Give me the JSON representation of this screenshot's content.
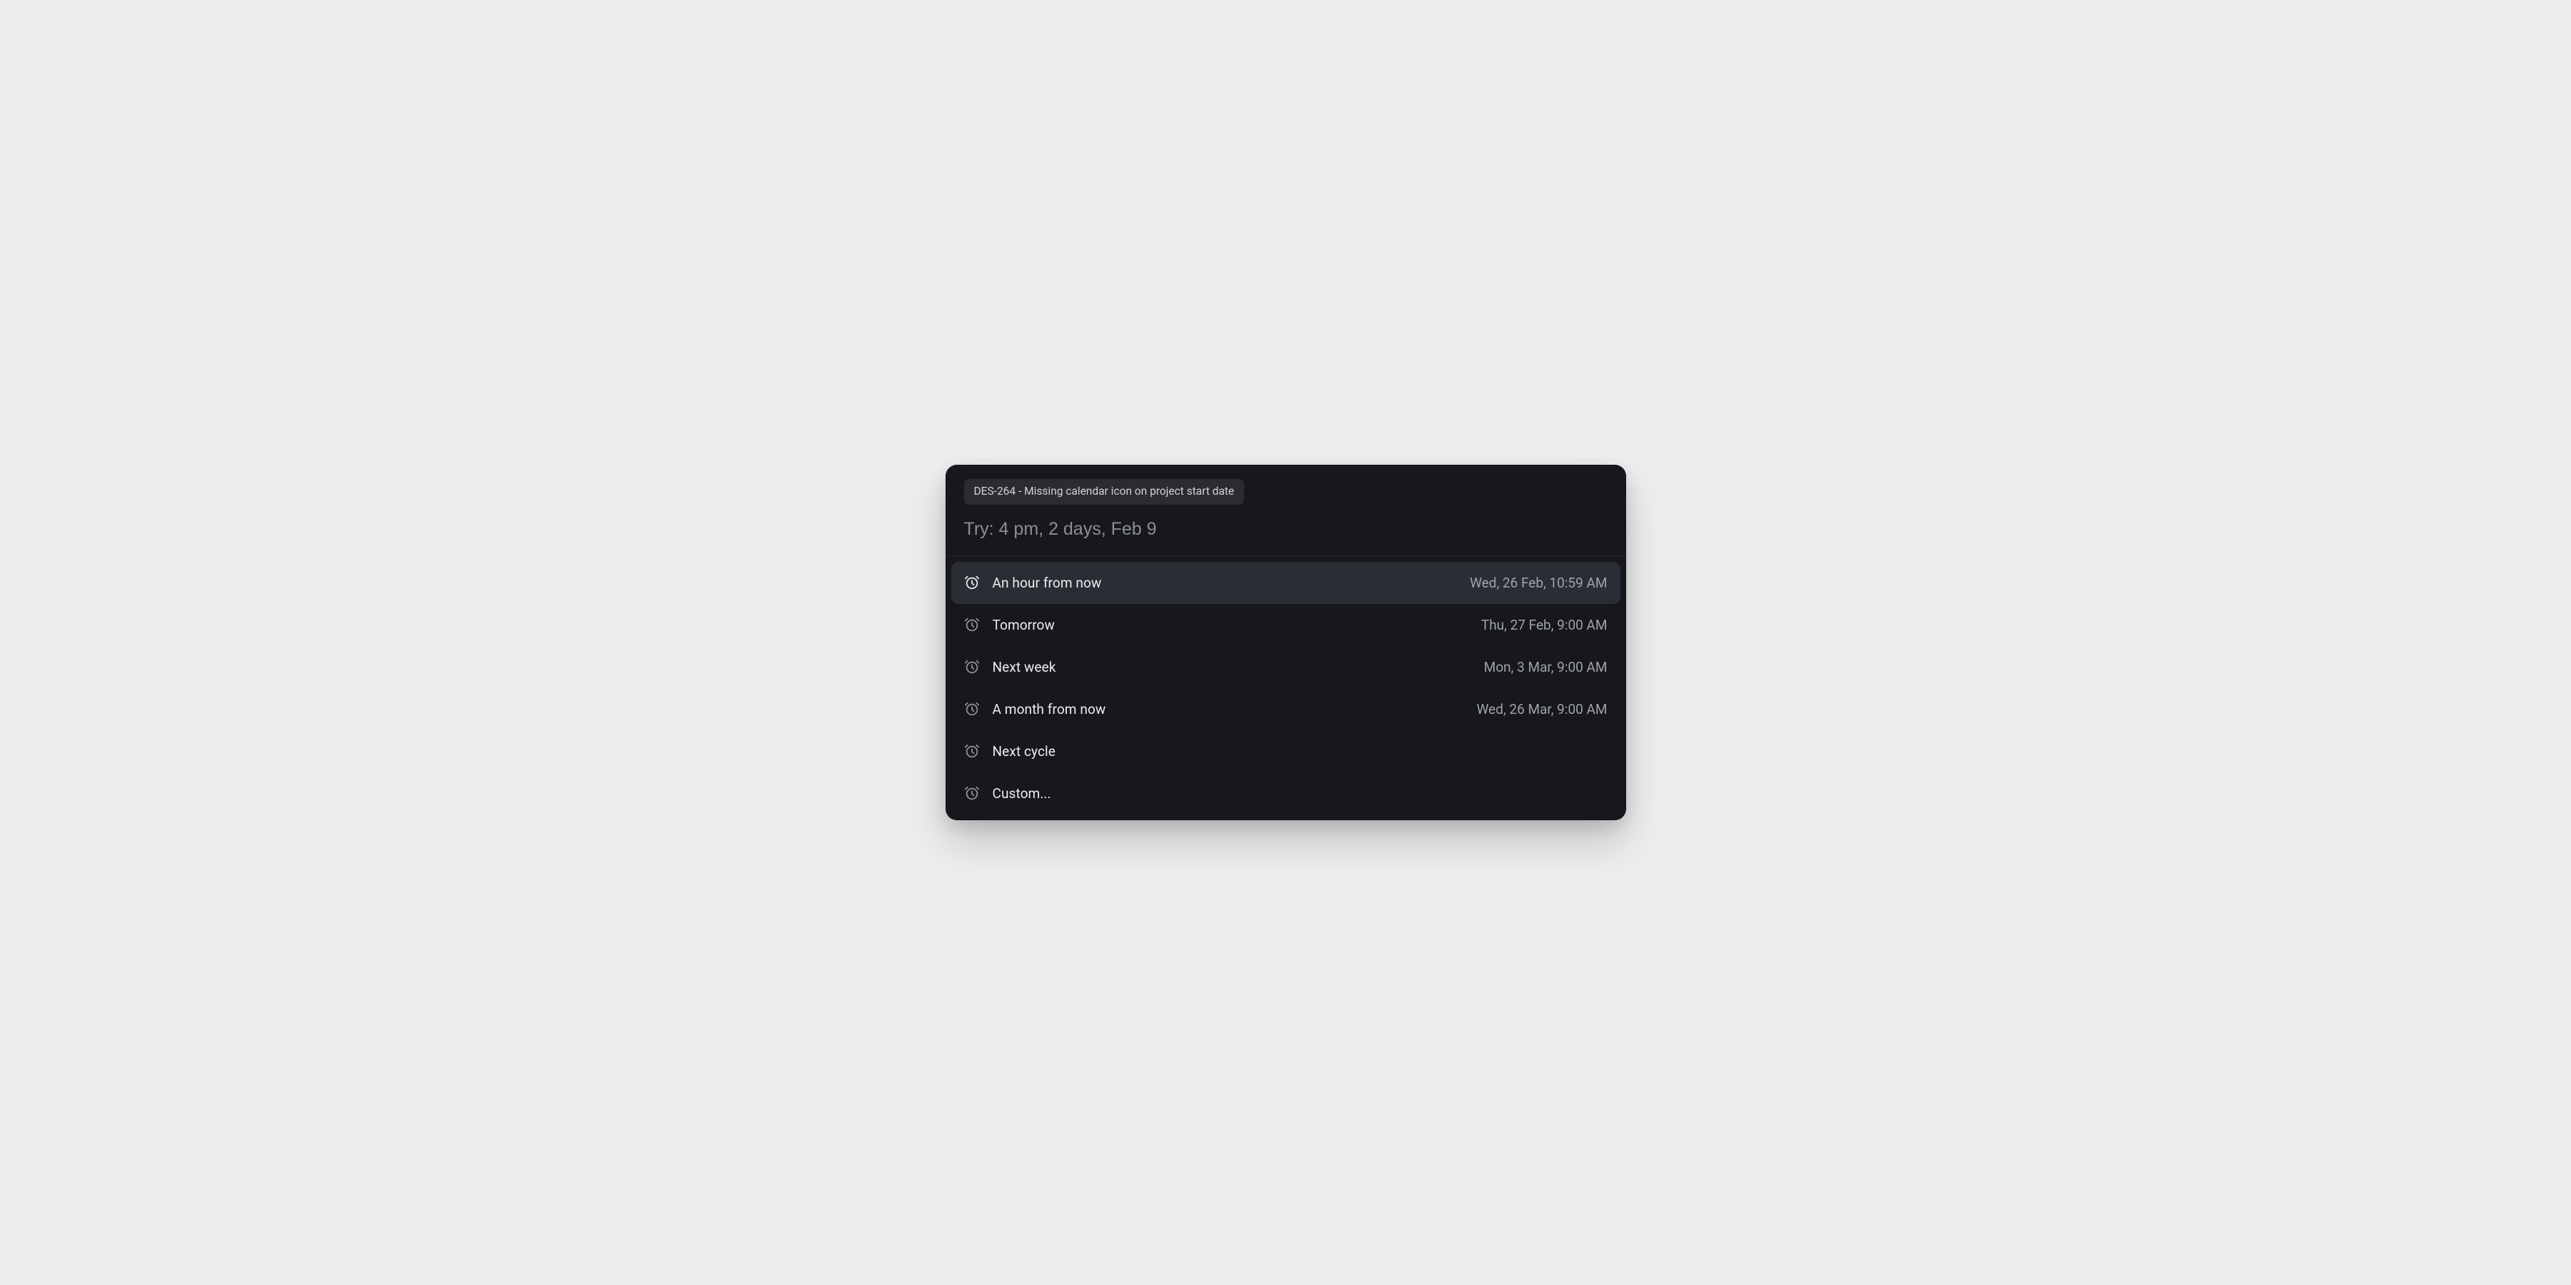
{
  "header": {
    "context_chip": "DES-264 - Missing calendar icon on project start date",
    "search_placeholder": "Try: 4 pm, 2 days, Feb 9"
  },
  "options": [
    {
      "id": "hour",
      "label": "An hour from now",
      "timestamp": "Wed, 26 Feb, 10:59 AM",
      "selected": true
    },
    {
      "id": "tomorrow",
      "label": "Tomorrow",
      "timestamp": "Thu, 27 Feb, 9:00 AM",
      "selected": false
    },
    {
      "id": "next-week",
      "label": "Next week",
      "timestamp": "Mon, 3 Mar, 9:00 AM",
      "selected": false
    },
    {
      "id": "month",
      "label": "A month from now",
      "timestamp": "Wed, 26 Mar, 9:00 AM",
      "selected": false
    },
    {
      "id": "cycle",
      "label": "Next cycle",
      "timestamp": "",
      "selected": false
    },
    {
      "id": "custom",
      "label": "Custom...",
      "timestamp": "",
      "selected": false
    }
  ]
}
